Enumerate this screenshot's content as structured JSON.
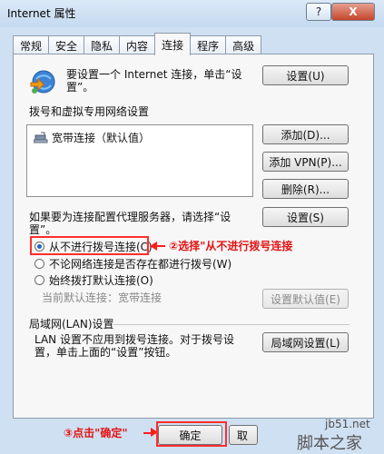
{
  "window": {
    "title": "Internet 属性",
    "help_label": "?",
    "close_label": "X"
  },
  "tabs": [
    "常规",
    "安全",
    "隐私",
    "内容",
    "连接",
    "程序",
    "高级"
  ],
  "active_tab": "连接",
  "connect": {
    "text1": "要设置一个 Internet 连接，单击“设",
    "text2": "置”。",
    "setup_label": "设置(U)"
  },
  "dialup": {
    "section_title": "拨号和虚拟专用网络设置",
    "items": [
      "宽带连接（默认值）"
    ],
    "add_label": "添加(D)...",
    "add_vpn_label": "添加 VPN(P)...",
    "remove_label": "删除(R)...",
    "proxy_text1": "如果要为连接配置代理服务器，请选择“设",
    "proxy_text2": "置”。",
    "settings_label": "设置(S)",
    "radio_never": "从不进行拨号连接(C)",
    "radio_whenever": "不论网络连接是否存在都进行拨号(W)",
    "radio_always": "始终拨打默认连接(O)",
    "current_default": "当前默认连接：宽带连接",
    "set_default_label": "设置默认值(E)"
  },
  "lan": {
    "section_title": "局域网(LAN)设置",
    "text1": "LAN 设置不应用到拨号连接。对于拨号设",
    "text2": "置，单击上面的“设置”按钮。",
    "lan_settings_label": "局域网设置(L)"
  },
  "footer": {
    "ok_label": "确定",
    "cancel_label": "取"
  },
  "annotations": {
    "step2": "②选择\"从不进行拨号连接",
    "step3": "③点击\"确定\""
  },
  "watermark": {
    "small": "jb51.net",
    "big": "脚本之家"
  }
}
